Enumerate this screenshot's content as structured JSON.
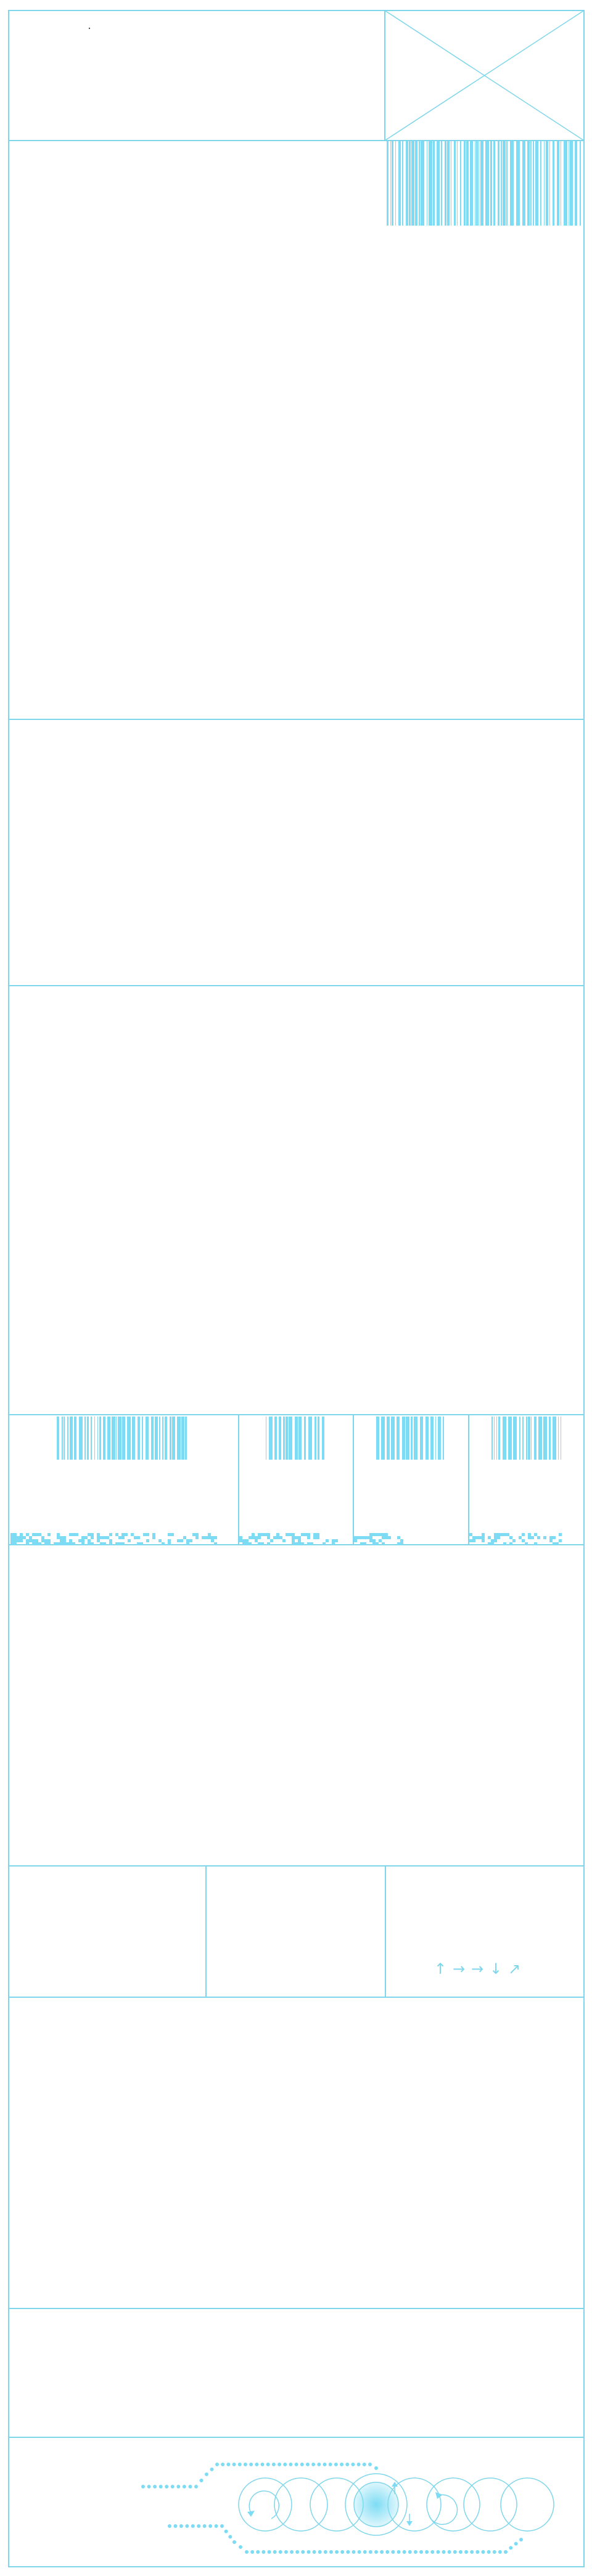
{
  "palette": {
    "line": "#7fd6ea",
    "fill": "#7ddcf4",
    "background": "#ffffff"
  },
  "icons": {
    "image_placeholder": "image-placeholder-icon",
    "barcode": "barcode-icon",
    "pixel_noise": "pixel-noise-icon",
    "arrows": "direction-arrows-icon",
    "carousel": "carousel-circles-icon"
  },
  "arrow_glyphs": [
    "↑",
    "→",
    "→",
    "↓",
    "↗"
  ]
}
